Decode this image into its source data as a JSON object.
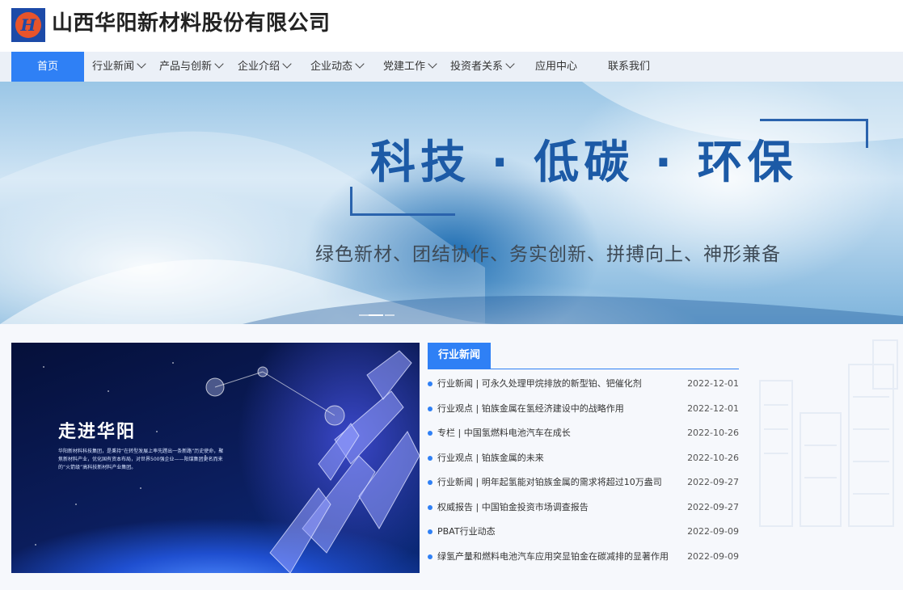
{
  "header": {
    "company_name": "山西华阳新材料股份有限公司",
    "logo_icon": "company-logo-icon",
    "colors": {
      "logo_blue": "#1c4aa8",
      "logo_orange": "#e8542b"
    }
  },
  "nav": {
    "items": [
      {
        "label": "首页",
        "active": true
      },
      {
        "label": "行业新闻",
        "dropdown": true
      },
      {
        "label": "产品与创新",
        "dropdown": true
      },
      {
        "label": "企业介绍",
        "dropdown": true
      },
      {
        "label": "企业动态",
        "dropdown": true
      },
      {
        "label": "党建工作",
        "dropdown": true
      },
      {
        "label": "投资者关系",
        "dropdown": true
      },
      {
        "label": "应用中心"
      },
      {
        "label": "联系我们"
      }
    ],
    "active_color": "#2f80f5"
  },
  "banner": {
    "title": "科技 · 低碳 · 环保",
    "subtitle": "绿色新材、团结协作、务实创新、拼搏向上、神形兼备"
  },
  "about": {
    "title": "走进华阳",
    "text": "华阳新材料科技集团，是秉持“在转型发展上率先蹚出一条新路”历史使命，聚焦新材料产业，优化国有资本布局，对世界500强企业——阳煤集团更名而来的“火箭级”高科技新材料产业集团。"
  },
  "news": {
    "tab_label": "行业新闻",
    "items": [
      {
        "title": "行业新闻 | 可永久处理甲烷排放的新型铂、钯催化剂",
        "date": "2022-12-01"
      },
      {
        "title": "行业观点 | 铂族金属在氢经济建设中的战略作用",
        "date": "2022-12-01"
      },
      {
        "title": "专栏 | 中国氢燃料电池汽车在成长",
        "date": "2022-10-26"
      },
      {
        "title": "行业观点 | 铂族金属的未来",
        "date": "2022-10-26"
      },
      {
        "title": "行业新闻 | 明年起氢能对铂族金属的需求将超过10万盎司",
        "date": "2022-09-27"
      },
      {
        "title": "权威报告 | 中国铂金投资市场调查报告",
        "date": "2022-09-27"
      },
      {
        "title": "PBAT行业动态",
        "date": "2022-09-09"
      },
      {
        "title": "绿氢产量和燃料电池汽车应用突显铂金在碳减排的显著作用",
        "date": "2022-09-09"
      }
    ]
  }
}
